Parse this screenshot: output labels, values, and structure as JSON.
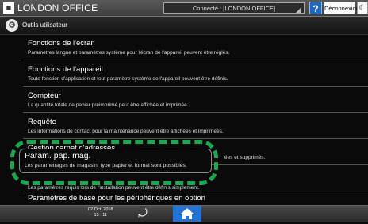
{
  "topbar": {
    "title": "LONDON OFFICE",
    "connection_status": "Connecté : [LONDON OFFICE]",
    "help_label": "?",
    "logout_label": "Déconnexion",
    "energy_glyph": "☾"
  },
  "section": {
    "title": "Outils utilisateur"
  },
  "menu": {
    "items": [
      {
        "title": "Fonctions de l'écran",
        "description": "Paramètres langue et paramètres système pour l'écran de l'appareil peuvent être réglés."
      },
      {
        "title": "Fonctions de l'appareil",
        "description": "Toute fonction d'application et tout paramètre système de l'appareil peuvent être définis."
      },
      {
        "title": "Compteur",
        "description": "La quantité totale de papier préimprimé peut être affichée et imprimée."
      },
      {
        "title": "Requête",
        "description": "Les informations de contact pour la maintenance peuvent être affichées et imprimées."
      },
      {
        "title": "Gestion carnet d'adresses",
        "description": "ées et supprimés."
      },
      {
        "title": "Param. pap. mag.",
        "description": "Les paramétrages de magasin, type papier et format sont possibles."
      },
      {
        "title": "",
        "description": "Les paramètres requis lors de l'installation peuvent être définis simplement."
      },
      {
        "title": "Paramètres de base pour les périphériques en option",
        "description": ""
      }
    ]
  },
  "bottombar": {
    "date": "02 Oct. 2018",
    "time": "15 : 11"
  },
  "icons": {
    "user": "user-icon",
    "tools": "tools-icon",
    "back": "back-arrow-icon",
    "home": "home-icon"
  },
  "colors": {
    "highlight_dash": "#19a84f",
    "home_button": "#2472d3",
    "help_button": "#1d69c6"
  }
}
